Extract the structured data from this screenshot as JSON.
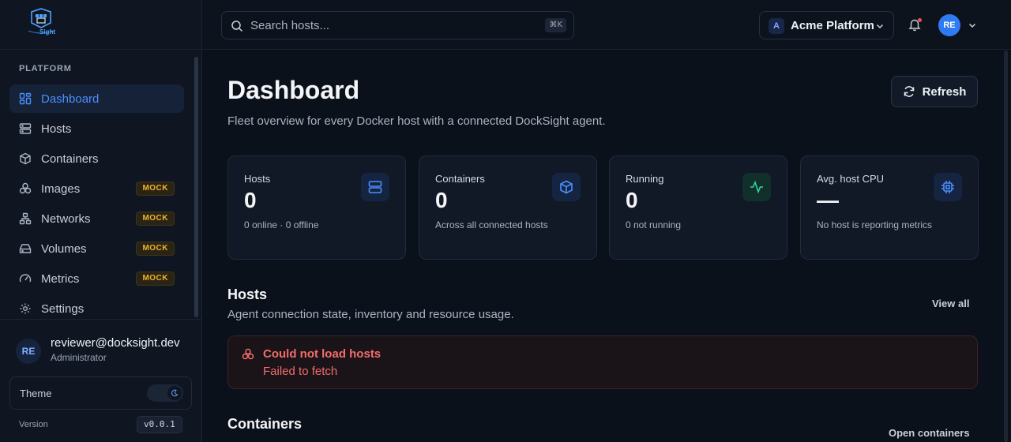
{
  "sidebar": {
    "brand": "Sight",
    "section_label": "PLATFORM",
    "items": [
      {
        "label": "Dashboard",
        "icon": "dashboard-icon",
        "active": true
      },
      {
        "label": "Hosts",
        "icon": "server-icon"
      },
      {
        "label": "Containers",
        "icon": "container-box-icon"
      },
      {
        "label": "Images",
        "icon": "layers-icon",
        "badge": "MOCK"
      },
      {
        "label": "Networks",
        "icon": "network-icon",
        "badge": "MOCK"
      },
      {
        "label": "Volumes",
        "icon": "hard-drive-icon",
        "badge": "MOCK"
      },
      {
        "label": "Metrics",
        "icon": "gauge-icon",
        "badge": "MOCK"
      },
      {
        "label": "Settings",
        "icon": "gear-icon"
      }
    ],
    "user": {
      "initials": "RE",
      "email": "reviewer@docksight.dev",
      "role": "Administrator"
    },
    "theme_label": "Theme",
    "version_label": "Version",
    "version": "v0.0.1"
  },
  "topbar": {
    "search_placeholder": "Search hosts...",
    "shortcut": "⌘K",
    "org_initial": "A",
    "org_name": "Acme Platform",
    "user_initials": "RE"
  },
  "page": {
    "title": "Dashboard",
    "subtitle": "Fleet overview for every Docker host with a connected DockSight agent.",
    "refresh_label": "Refresh"
  },
  "stats": [
    {
      "label": "Hosts",
      "value": "0",
      "sub": "0 online · 0 offline",
      "icon": "server-icon"
    },
    {
      "label": "Containers",
      "value": "0",
      "sub": "Across all connected hosts",
      "icon": "container-box-icon"
    },
    {
      "label": "Running",
      "value": "0",
      "sub": "0 not running",
      "icon": "activity-icon"
    },
    {
      "label": "Avg. host CPU",
      "value": "—",
      "sub": "No host is reporting metrics",
      "icon": "cpu-icon"
    }
  ],
  "hosts_section": {
    "title": "Hosts",
    "subtitle": "Agent connection state, inventory and resource usage.",
    "link": "View all",
    "error_title": "Could not load hosts",
    "error_message": "Failed to fetch"
  },
  "containers_section": {
    "title": "Containers",
    "link": "Open containers"
  },
  "colors": {
    "accent": "#4b8fff",
    "badge": "#f0b429",
    "error": "#f26d6d",
    "success": "#34d399"
  }
}
